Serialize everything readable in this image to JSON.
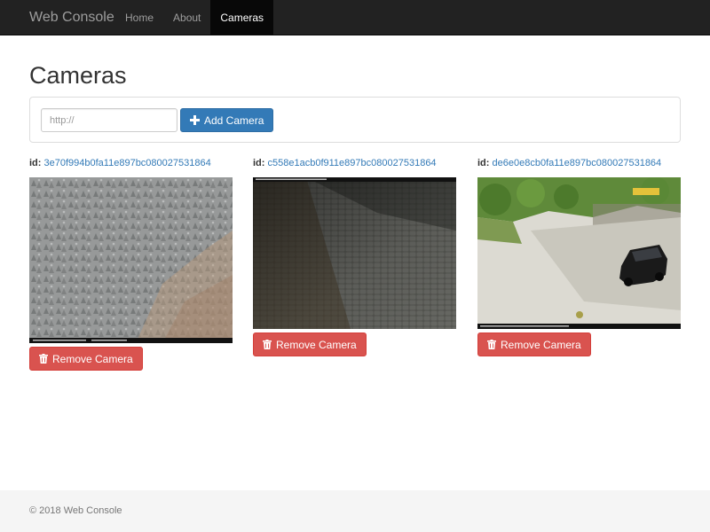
{
  "navbar": {
    "brand": "Web Console",
    "items": [
      {
        "label": "Home",
        "active": false
      },
      {
        "label": "About",
        "active": false
      },
      {
        "label": "Cameras",
        "active": true
      }
    ]
  },
  "page": {
    "title": "Cameras"
  },
  "add_form": {
    "url_placeholder": "http://",
    "url_value": "",
    "add_button_label": "Add Camera",
    "add_icon": "plus-icon"
  },
  "cameras": [
    {
      "id_label": "id:",
      "id": "3e70f994b0fa11e897bc080027531864",
      "image_description": "forest-aerial-view",
      "remove_label": "Remove Camera",
      "remove_icon": "trash-icon"
    },
    {
      "id_label": "id:",
      "id": "c558e1acb0f911e897bc080027531864",
      "image_description": "cobblestone-courtyard",
      "remove_label": "Remove Camera",
      "remove_icon": "trash-icon"
    },
    {
      "id_label": "id:",
      "id": "de6e0e8cb0fa11e897bc080027531864",
      "image_description": "parking-lot-with-car",
      "remove_label": "Remove Camera",
      "remove_icon": "trash-icon"
    }
  ],
  "footer": {
    "copyright": "© 2018 Web Console"
  },
  "colors": {
    "navbar_bg": "#222222",
    "primary": "#337ab7",
    "danger": "#d9534f",
    "link": "#337ab7",
    "footer_bg": "#f5f5f5"
  }
}
